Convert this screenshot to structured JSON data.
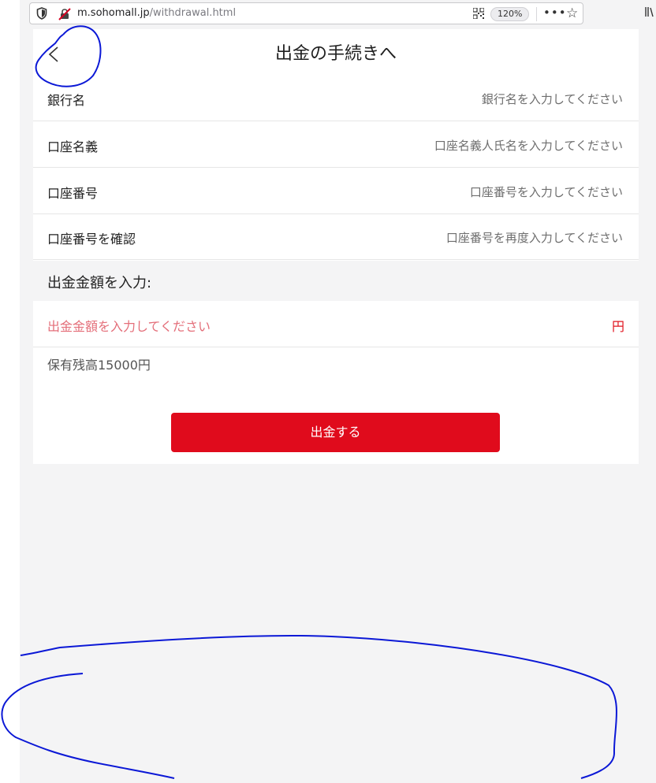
{
  "browser": {
    "url_host": "m.sohomall.jp",
    "url_path": "/withdrawal.html",
    "zoom": "120%"
  },
  "header": {
    "title": "出金の手続きへ"
  },
  "form": {
    "rows": [
      {
        "label": "銀行名",
        "placeholder": "銀行名を入力してください"
      },
      {
        "label": "口座名義",
        "placeholder": "口座名義人氏名を入力してください"
      },
      {
        "label": "口座番号",
        "placeholder": "口座番号を入力してください"
      },
      {
        "label": "口座番号を確認",
        "placeholder": "口座番号を再度入力してください"
      }
    ],
    "amount_heading": "出金金額を入力:",
    "amount_placeholder": "出金金額を入力してください",
    "currency": "円",
    "balance": "保有残高15000円",
    "submit_label": "出金する"
  },
  "colors": {
    "accent": "#e00b1c",
    "amount_placeholder": "#e46f7a",
    "page_bg": "#f4f4f5",
    "annotation": "#0b18d6"
  }
}
